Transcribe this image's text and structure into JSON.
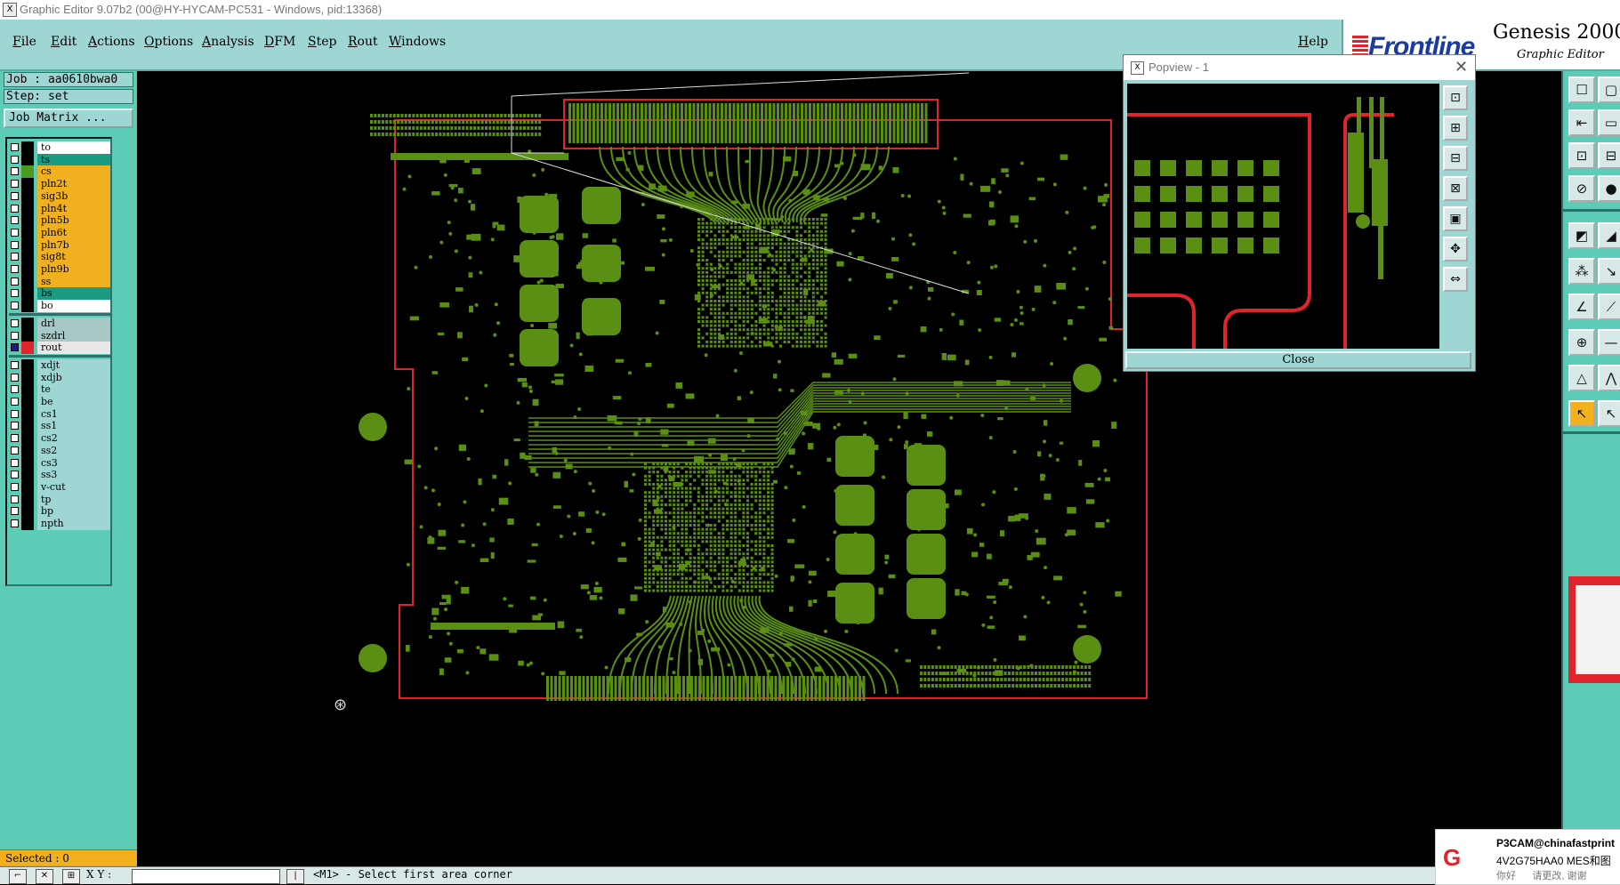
{
  "window": {
    "title": "Graphic Editor 9.07b2 (00@HY-HYCAM-PC531 - Windows, pid:13368)"
  },
  "menu": {
    "items": [
      "File",
      "Edit",
      "Actions",
      "Options",
      "Analysis",
      "DFM",
      "Step",
      "Rout",
      "Windows"
    ],
    "help": "Help"
  },
  "brand": {
    "logo": "Frontline",
    "title": "Genesis 2000",
    "subtitle": "Graphic Editor"
  },
  "job": {
    "job_line": "Job : aa0610bwa0",
    "step_line": "Step: set",
    "matrix_button": "Job Matrix ..."
  },
  "colors": {
    "board": "#5b8f14",
    "outline": "#e0242c",
    "panel": "#5dccb6",
    "menubar": "#9dd6d3"
  },
  "layers": [
    {
      "name": "to",
      "color": "#ffffff",
      "swatch": "#000000",
      "checked": false
    },
    {
      "name": "ts",
      "color": "#1b9c82",
      "swatch": "#000000",
      "checked": false
    },
    {
      "name": "cs",
      "color": "#f1b11f",
      "swatch": "#4a9b1f",
      "checked": false
    },
    {
      "name": "pln2t",
      "color": "#f1b11f",
      "swatch": "#000000",
      "checked": false
    },
    {
      "name": "sig3b",
      "color": "#f1b11f",
      "swatch": "#000000",
      "checked": false
    },
    {
      "name": "pln4t",
      "color": "#f1b11f",
      "swatch": "#000000",
      "checked": false
    },
    {
      "name": "pln5b",
      "color": "#f1b11f",
      "swatch": "#000000",
      "checked": false
    },
    {
      "name": "pln6t",
      "color": "#f1b11f",
      "swatch": "#000000",
      "checked": false
    },
    {
      "name": "pln7b",
      "color": "#f1b11f",
      "swatch": "#000000",
      "checked": false
    },
    {
      "name": "sig8t",
      "color": "#f1b11f",
      "swatch": "#000000",
      "checked": false
    },
    {
      "name": "pln9b",
      "color": "#f1b11f",
      "swatch": "#000000",
      "checked": false
    },
    {
      "name": "ss",
      "color": "#f1b11f",
      "swatch": "#000000",
      "checked": false
    },
    {
      "name": "bs",
      "color": "#1b9c82",
      "swatch": "#000000",
      "checked": false
    },
    {
      "name": "bo",
      "color": "#ffffff",
      "swatch": "#000000",
      "checked": false
    },
    {
      "name": "drl",
      "color": "#a8c8c6",
      "swatch": "#000000",
      "checked": false
    },
    {
      "name": "szdrl",
      "color": "#a8c8c6",
      "swatch": "#000000",
      "checked": false
    },
    {
      "name": "rout",
      "color": "#e8e8e8",
      "swatch": "#e0242c",
      "checked": true
    },
    {
      "name": "xdjt",
      "color": "#9dd6d3",
      "swatch": "#000000",
      "checked": false
    },
    {
      "name": "xdjb",
      "color": "#9dd6d3",
      "swatch": "#000000",
      "checked": false
    },
    {
      "name": "te",
      "color": "#9dd6d3",
      "swatch": "#000000",
      "checked": false
    },
    {
      "name": "be",
      "color": "#9dd6d3",
      "swatch": "#000000",
      "checked": false
    },
    {
      "name": "cs1",
      "color": "#9dd6d3",
      "swatch": "#000000",
      "checked": false
    },
    {
      "name": "ss1",
      "color": "#9dd6d3",
      "swatch": "#000000",
      "checked": false
    },
    {
      "name": "cs2",
      "color": "#9dd6d3",
      "swatch": "#000000",
      "checked": false
    },
    {
      "name": "ss2",
      "color": "#9dd6d3",
      "swatch": "#000000",
      "checked": false
    },
    {
      "name": "cs3",
      "color": "#9dd6d3",
      "swatch": "#000000",
      "checked": false
    },
    {
      "name": "ss3",
      "color": "#9dd6d3",
      "swatch": "#000000",
      "checked": false
    },
    {
      "name": "v-cut",
      "color": "#9dd6d3",
      "swatch": "#000000",
      "checked": false
    },
    {
      "name": "tp",
      "color": "#9dd6d3",
      "swatch": "#000000",
      "checked": false
    },
    {
      "name": "bp",
      "color": "#9dd6d3",
      "swatch": "#000000",
      "checked": false
    },
    {
      "name": "npth",
      "color": "#9dd6d3",
      "swatch": "#000000",
      "checked": false
    }
  ],
  "status": {
    "selected": "Selected : 0",
    "xy_label": "X Y :",
    "prompt": "<M1> - Select first area corner"
  },
  "popview": {
    "title": "Popview - 1",
    "close_label": "Close"
  },
  "toast": {
    "name": "P3CAM@chinafastprint",
    "message": "4V2G75HAA0  MES和图",
    "meta_left": "你好",
    "meta_right": "请更改, 谢谢"
  }
}
